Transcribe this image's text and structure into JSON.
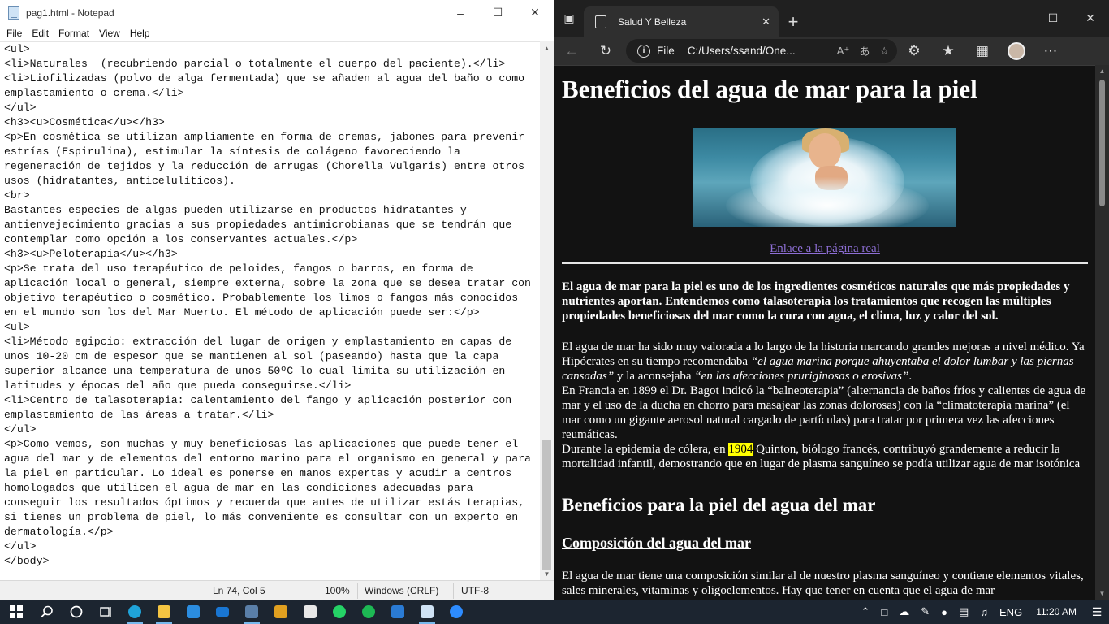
{
  "notepad": {
    "title": "pag1.html - Notepad",
    "menu": [
      "File",
      "Edit",
      "Format",
      "View",
      "Help"
    ],
    "lines": [
      "<ul>",
      "<li>Naturales  (recubriendo parcial o totalmente el cuerpo del paciente).</li>",
      "<li>Liofilizadas (polvo de alga fermentada) que se añaden al agua del baño o como",
      "emplastamiento o crema.</li>",
      "</ul>",
      "<h3><u>Cosmética</u></h3>",
      "<p>En cosmética se utilizan ampliamente en forma de cremas, jabones para prevenir",
      "estrías (Espirulina), estimular la síntesis de colágeno favoreciendo la",
      "regeneración de tejidos y la reducción de arrugas (Chorella Vulgaris) entre otros",
      "usos (hidratantes, anticelulíticos).",
      "<br>",
      "Bastantes especies de algas pueden utilizarse en productos hidratantes y",
      "antienvejecimiento gracias a sus propiedades antimicrobianas que se tendrán que",
      "contemplar como opción a los conservantes actuales.</p>",
      "<h3><u>Peloterapia</u></h3>",
      "<p>Se trata del uso terapéutico de peloides, fangos o barros, en forma de",
      "aplicación local o general, siempre externa, sobre la zona que se desea tratar con",
      "objetivo terapéutico o cosmético. Probablemente los limos o fangos más conocidos",
      "en el mundo son los del Mar Muerto. El método de aplicación puede ser:</p>",
      "<ul>",
      "<li>Método egipcio: extracción del lugar de origen y emplastamiento en capas de",
      "unos 10-20 cm de espesor que se mantienen al sol (paseando) hasta que la capa",
      "superior alcance una temperatura de unos 50ºC lo cual limita su utilización en",
      "latitudes y épocas del año que pueda conseguirse.</li>",
      "<li>Centro de talasoterapia: calentamiento del fango y aplicación posterior con",
      "emplastamiento de las áreas a tratar.</li>",
      "</ul>",
      "<p>Como vemos, son muchas y muy beneficiosas las aplicaciones que puede tener el",
      "agua del mar y de elementos del entorno marino para el organismo en general y para",
      "la piel en particular. Lo ideal es ponerse en manos expertas y acudir a centros",
      "homologados que utilicen el agua de mar en las condiciones adecuadas para",
      "conseguir los resultados óptimos y recuerda que antes de utilizar estás terapias,",
      "si tienes un problema de piel, lo más conveniente es consultar con un experto en",
      "dermatología.</p>",
      "</ul>",
      "</body>"
    ],
    "status": {
      "position": "Ln 74, Col 5",
      "zoom": "100%",
      "line_ending": "Windows (CRLF)",
      "encoding": "UTF-8"
    }
  },
  "browser": {
    "tab_title": "Salud Y Belleza",
    "address_label": "File",
    "address_url": "C:/Users/ssand/One...",
    "page": {
      "h1": "Beneficios del agua de mar para la piel",
      "link": "Enlace a la página real",
      "intro": "El agua de mar para la piel es uno de los ingredientes cosméticos naturales que más propiedades y nutrientes aportan. Entendemos como talasoterapia los tratamientos que recogen las múltiples propiedades beneficiosas del mar como la cura con agua, el clima, luz y calor del sol.",
      "p1_a": "El agua de mar ha sido muy valorada a lo largo de la historia marcando grandes mejoras a nivel médico. Ya Hipócrates en su tiempo recomendaba ",
      "p1_q1": "“el agua marina porque ahuyentaba el dolor lumbar y las piernas cansadas”",
      "p1_b": " y la aconsejaba ",
      "p1_q2": "“en las afecciones pruriginosas o erosivas”",
      "p1_c": ".",
      "p2": "En Francia en 1899 el Dr. Bagot indicó la “balneoterapia” (alternancia de baños fríos y calientes de agua de mar y el uso de la ducha en chorro para masajear las zonas dolorosas) con la “climatoterapia marina” (el mar como un gigante aerosol natural cargado de partículas) para tratar por primera vez las afecciones reumáticas.",
      "p3_a": "Durante la epidemia de cólera, en ",
      "p3_mark": "1904",
      "p3_b": " Quinton, biólogo francés, contribuyó grandemente a reducir la mortalidad infantil, demostrando que en lugar de plasma sanguíneo se podía utilizar agua de mar isotónica",
      "h2": "Beneficios para la piel del agua del mar",
      "h3": "Composición del agua del mar",
      "p4": "El agua de mar tiene una composición similar al de nuestro plasma sanguíneo y contiene elementos vitales, sales minerales, vitaminas y oligoelementos. Hay que tener en cuenta que el agua de mar"
    }
  },
  "taskbar": {
    "language": "ENG",
    "time": "11:20 AM"
  },
  "colors": {
    "highlight": "#ffff00",
    "link": "#8e6fd6",
    "taskbar": "#1c2530"
  }
}
